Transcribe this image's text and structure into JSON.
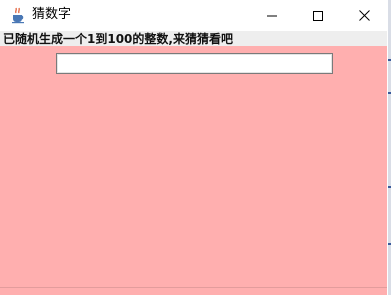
{
  "window": {
    "title": "猜数字",
    "icon": "java-cup-icon"
  },
  "title_controls": {
    "minimize_icon": "minimize-icon",
    "maximize_icon": "maximize-icon",
    "close_icon": "close-icon"
  },
  "hint": {
    "text": "已随机生成一个1到100的整数,来猜猜看吧"
  },
  "guess_input": {
    "value": "",
    "placeholder": ""
  },
  "colors": {
    "content_background": "#ffafaf",
    "label_row_background": "#eeeeee"
  }
}
